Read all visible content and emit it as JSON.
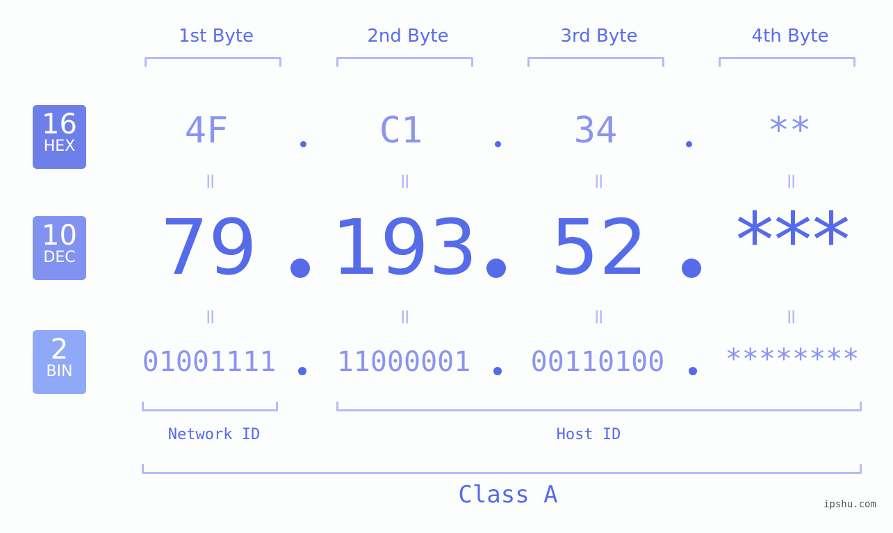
{
  "byte_headers": [
    "1st Byte",
    "2nd Byte",
    "3rd Byte",
    "4th Byte"
  ],
  "badges": {
    "hex": {
      "num": "16",
      "label": "HEX",
      "color": "#6e7fea"
    },
    "dec": {
      "num": "10",
      "label": "DEC",
      "color": "#8192f0"
    },
    "bin": {
      "num": "2",
      "label": "BIN",
      "color": "#8fa8f8"
    }
  },
  "hex": [
    "4F",
    "C1",
    "34",
    "**"
  ],
  "dec": [
    "79",
    "193",
    "52",
    "***"
  ],
  "bin": [
    "01001111",
    "11000001",
    "00110100",
    "********"
  ],
  "equals_symbol": "=",
  "labels": {
    "network_id": "Network ID",
    "host_id": "Host ID",
    "class": "Class A"
  },
  "brand": "ipshu.com",
  "colors": {
    "accent": "#566bea",
    "light": "#8a95ee",
    "bracket": "#b3bcf7",
    "background": "#fcfdfd"
  }
}
